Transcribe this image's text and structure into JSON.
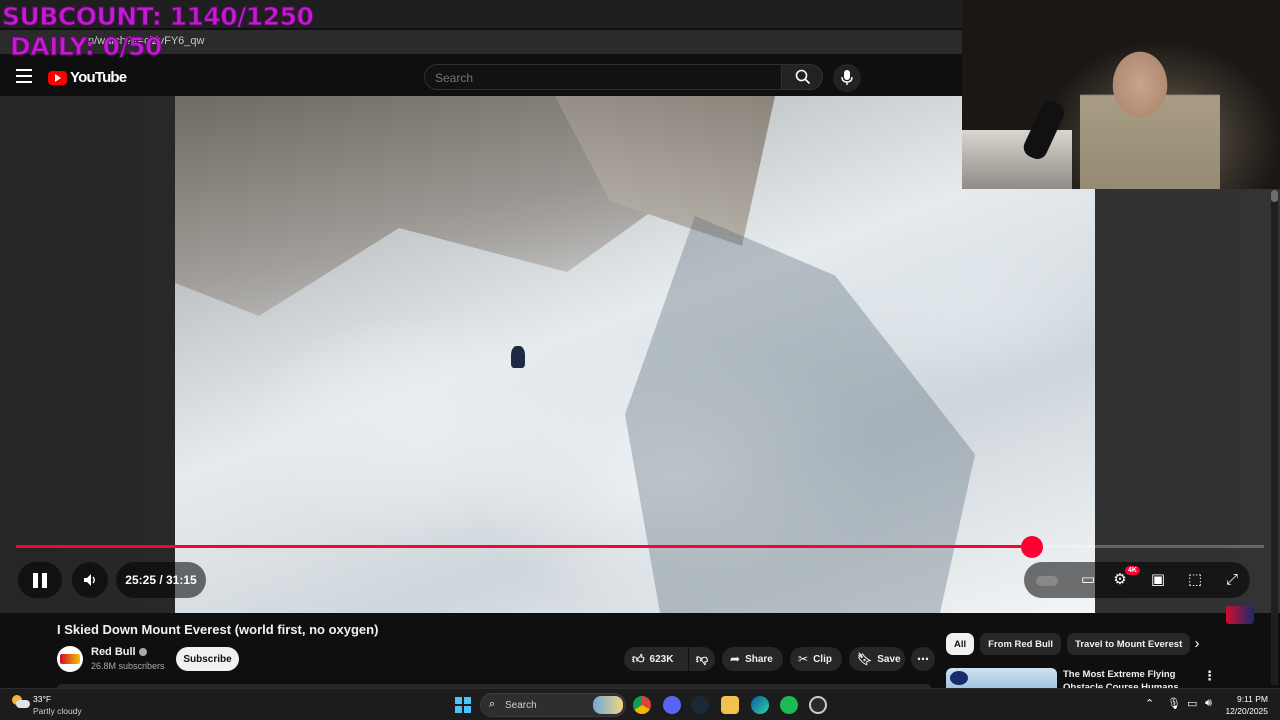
{
  "overlay": {
    "subcount": "SUBCOUNT: 1140/1250",
    "daily": "DAILY: 0/50"
  },
  "browser": {
    "url": "n/watch?v=cjZvFY6_qw"
  },
  "header": {
    "logo_text": "YouTube",
    "search_placeholder": "Search"
  },
  "player": {
    "time": "25:25 / 31:15",
    "progress_fraction": 0.814,
    "quality_badge": "4K",
    "colors": {
      "accent": "#ff0033"
    }
  },
  "video": {
    "title": "I Skied Down Mount Everest (world first, no oxygen)",
    "channel_name": "Red Bull",
    "subscribers": "26.8M subscribers",
    "subscribe_label": "Subscribe",
    "likes": "623K",
    "share_label": "Share",
    "clip_label": "Clip",
    "save_label": "Save"
  },
  "sidebar": {
    "chips": [
      "All",
      "From Red Bull",
      "Travel to Mount Everest"
    ],
    "recommendation_title": "The Most Extreme Flying Obstacle Course Humans Hav..."
  },
  "taskbar": {
    "temperature": "33°F",
    "condition": "Partly cloudy",
    "search_label": "Search",
    "time": "9:11 PM",
    "date": "12/20/2025"
  }
}
